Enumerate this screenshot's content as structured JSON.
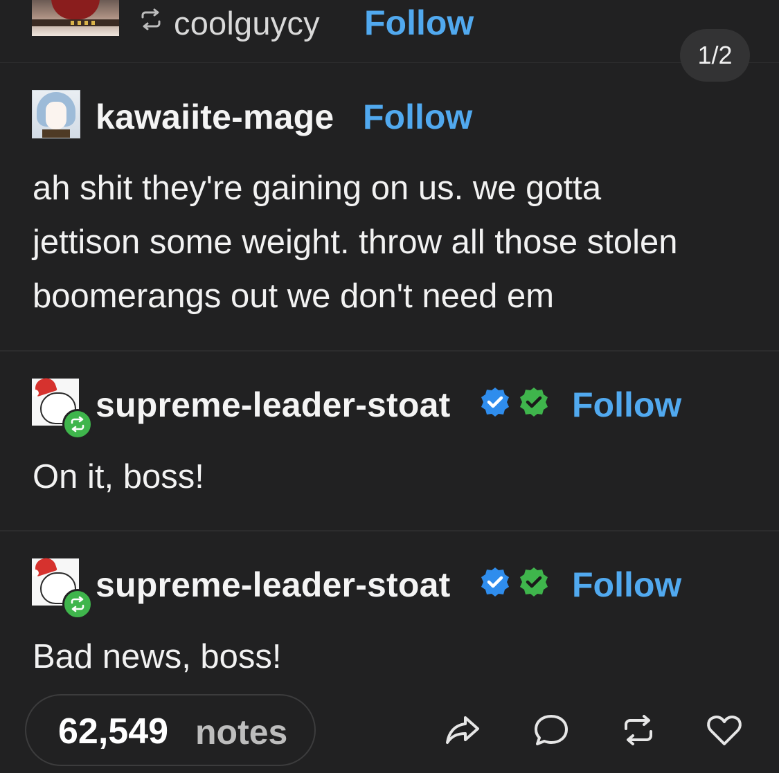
{
  "reblog": {
    "username": "coolguycy",
    "follow_label": "Follow",
    "icon": "reblog-icon"
  },
  "page_counter": "1/2",
  "posts": [
    {
      "username": "kawaiite-mage",
      "follow_label": "Follow",
      "body": "ah shit they're gaining on us. we gotta jettison some weight. throw all those stolen boomerangs out we don't need em",
      "body_lines": [
        "ah shit they're gaining on us. we gotta",
        "jettison some weight. throw all those stolen",
        "boomerangs out we don't need em"
      ]
    },
    {
      "username": "supreme-leader-stoat",
      "follow_label": "Follow",
      "badges": [
        "blue-verified-icon",
        "green-verified-icon"
      ],
      "body": "On it, boss!"
    },
    {
      "username": "supreme-leader-stoat",
      "follow_label": "Follow",
      "badges": [
        "blue-verified-icon",
        "green-verified-icon"
      ],
      "body": "Bad news, boss!"
    }
  ],
  "footer": {
    "notes_count": "62,549",
    "notes_label": "notes",
    "actions": [
      "share-icon",
      "reply-icon",
      "reblog-icon",
      "like-icon"
    ]
  },
  "colors": {
    "background": "#212122",
    "link": "#51a9ef",
    "verified_blue": "#2f8ded",
    "verified_green": "#3fb54c"
  }
}
